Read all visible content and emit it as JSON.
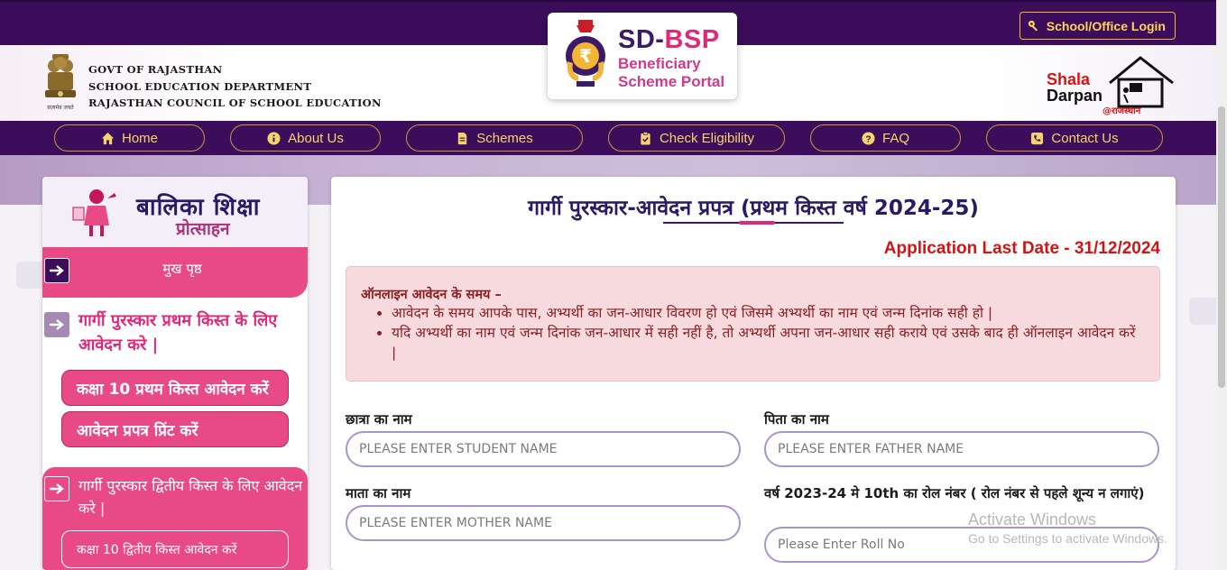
{
  "header": {
    "login_label": "School/Office Login",
    "govt_lines": [
      "GOVT OF RAJASTHAN",
      "SCHOOL EDUCATION DEPARTMENT",
      "RAJASTHAN COUNCIL OF SCHOOL EDUCATION"
    ],
    "emblem_caption": "सत्यमेव जयते",
    "logo": {
      "title_a": "SD-",
      "title_b": "BSP",
      "sub_1": "Beneficiary",
      "sub_2": "Scheme Portal"
    },
    "shala": {
      "line1_a": "Shala",
      "line2": "Darpan",
      "line3": "@राजस्थान"
    }
  },
  "nav": {
    "items": [
      {
        "label": "Home",
        "icon": "home-icon"
      },
      {
        "label": "About Us",
        "icon": "info-icon"
      },
      {
        "label": "Schemes",
        "icon": "document-icon"
      },
      {
        "label": "Check Eligibility",
        "icon": "clipboard-check-icon"
      },
      {
        "label": "FAQ",
        "icon": "question-icon"
      },
      {
        "label": "Contact Us",
        "icon": "phone-icon"
      }
    ]
  },
  "sidebar": {
    "title": "बालिका शिक्षा",
    "subtitle": "प्रोत्साहन",
    "home_label": "मुख पृष्ठ",
    "section1_title": "गार्गी पुरस्कार प्रथम किस्त के लिए आवेदन करे |",
    "section1_buttons": [
      "कक्षा 10 प्रथम किस्त आवेदन करें",
      "आवेदन प्रपत्र प्रिंट करें"
    ],
    "section2_title": "गार्गी पुरस्कार द्वितीय किस्त के लिए आवेदन करे |",
    "section2_button": "कक्षा 10 द्वितीय किस्त आवेदन करें"
  },
  "main": {
    "title": "गार्गी पुरस्कार-आवेदन प्रपत्र (प्रथम किस्त वर्ष 2024-25)",
    "last_date": "Application Last Date - 31/12/2024",
    "alert_head": "ऑनलाइन आवेदन के समय –",
    "alert_items": [
      "आवेदन के समय आपके पास, अभ्यर्थी का जन-आधार विवरण हो एवं जिसमे अभ्यर्थी का नाम एवं जन्म दिनांक सही हो |",
      "यदि अभ्यर्थी का नाम एवं जन्म दिनांक जन-आधार में सही नहीं है, तो अभ्यर्थी अपना जन-आधार सही कराये एवं उसके बाद ही ऑनलाइन आवेदन करें |"
    ],
    "fields": {
      "student_label": "छात्रा का नाम",
      "student_placeholder": "PLEASE ENTER STUDENT NAME",
      "father_label": "पिता का नाम",
      "father_placeholder": "PLEASE ENTER FATHER NAME",
      "mother_label": "माता का नाम",
      "mother_placeholder": "PLEASE ENTER MOTHER NAME",
      "roll_label": "वर्ष 2023-24 मे 10th का रोल नंबर ( रोल नंबर से पहले शून्य न लगाएं)",
      "roll_placeholder": "Please Enter Roll No"
    }
  },
  "watermark": {
    "line1": "Activate Windows",
    "line2": "Go to Settings to activate Windows."
  },
  "colors": {
    "brand_purple": "#3b0d5a",
    "accent_pink": "#e84a86",
    "gold": "#f2b535",
    "deadline_red": "#d41414"
  }
}
